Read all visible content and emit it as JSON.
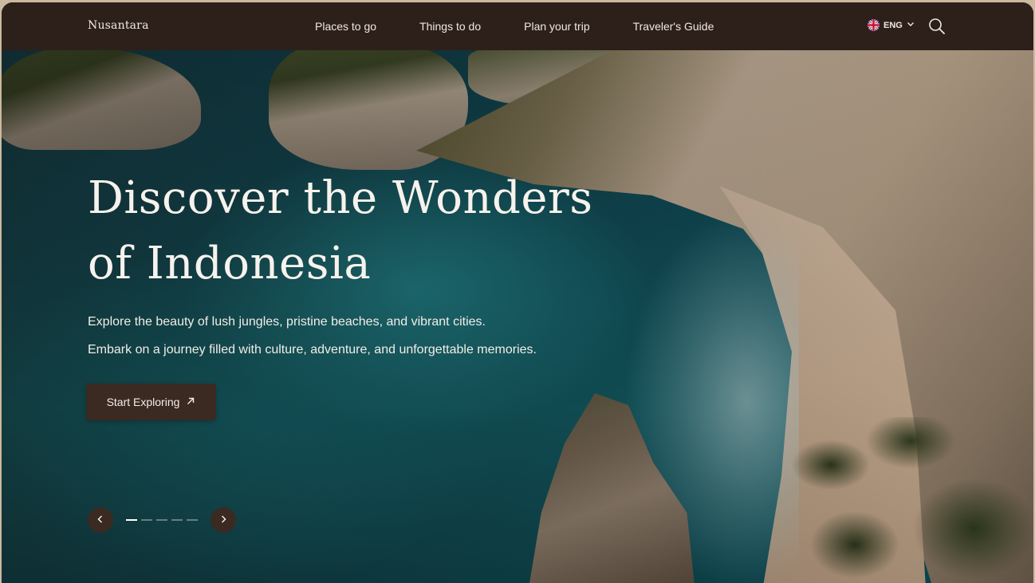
{
  "nav": {
    "brand": "Nusantara",
    "links": [
      {
        "label": "Places to go"
      },
      {
        "label": "Things to do"
      },
      {
        "label": "Plan your trip"
      },
      {
        "label": "Traveler's Guide"
      }
    ],
    "language": "ENG",
    "icons": {
      "flag": "uk-flag-icon",
      "lang_dropdown": "chevron-down-icon",
      "search": "search-icon"
    }
  },
  "hero": {
    "title_line1": "Discover the Wonders",
    "title_line2": "of Indonesia",
    "subtitle_line1": "Explore the beauty of lush jungles, pristine beaches, and vibrant cities.",
    "subtitle_line2": "Embark on a journey filled with culture, adventure, and unforgettable memories.",
    "cta_label": "Start Exploring",
    "cta_icon": "arrow-up-right-icon"
  },
  "carousel": {
    "active_slide": 1,
    "slide_count": 5,
    "prev_icon": "chevron-left-icon",
    "next_icon": "chevron-right-icon"
  },
  "colors": {
    "nav_bg": "#2d201a",
    "button_bg": "#3a2a22",
    "text_light": "#f7f2ec"
  }
}
